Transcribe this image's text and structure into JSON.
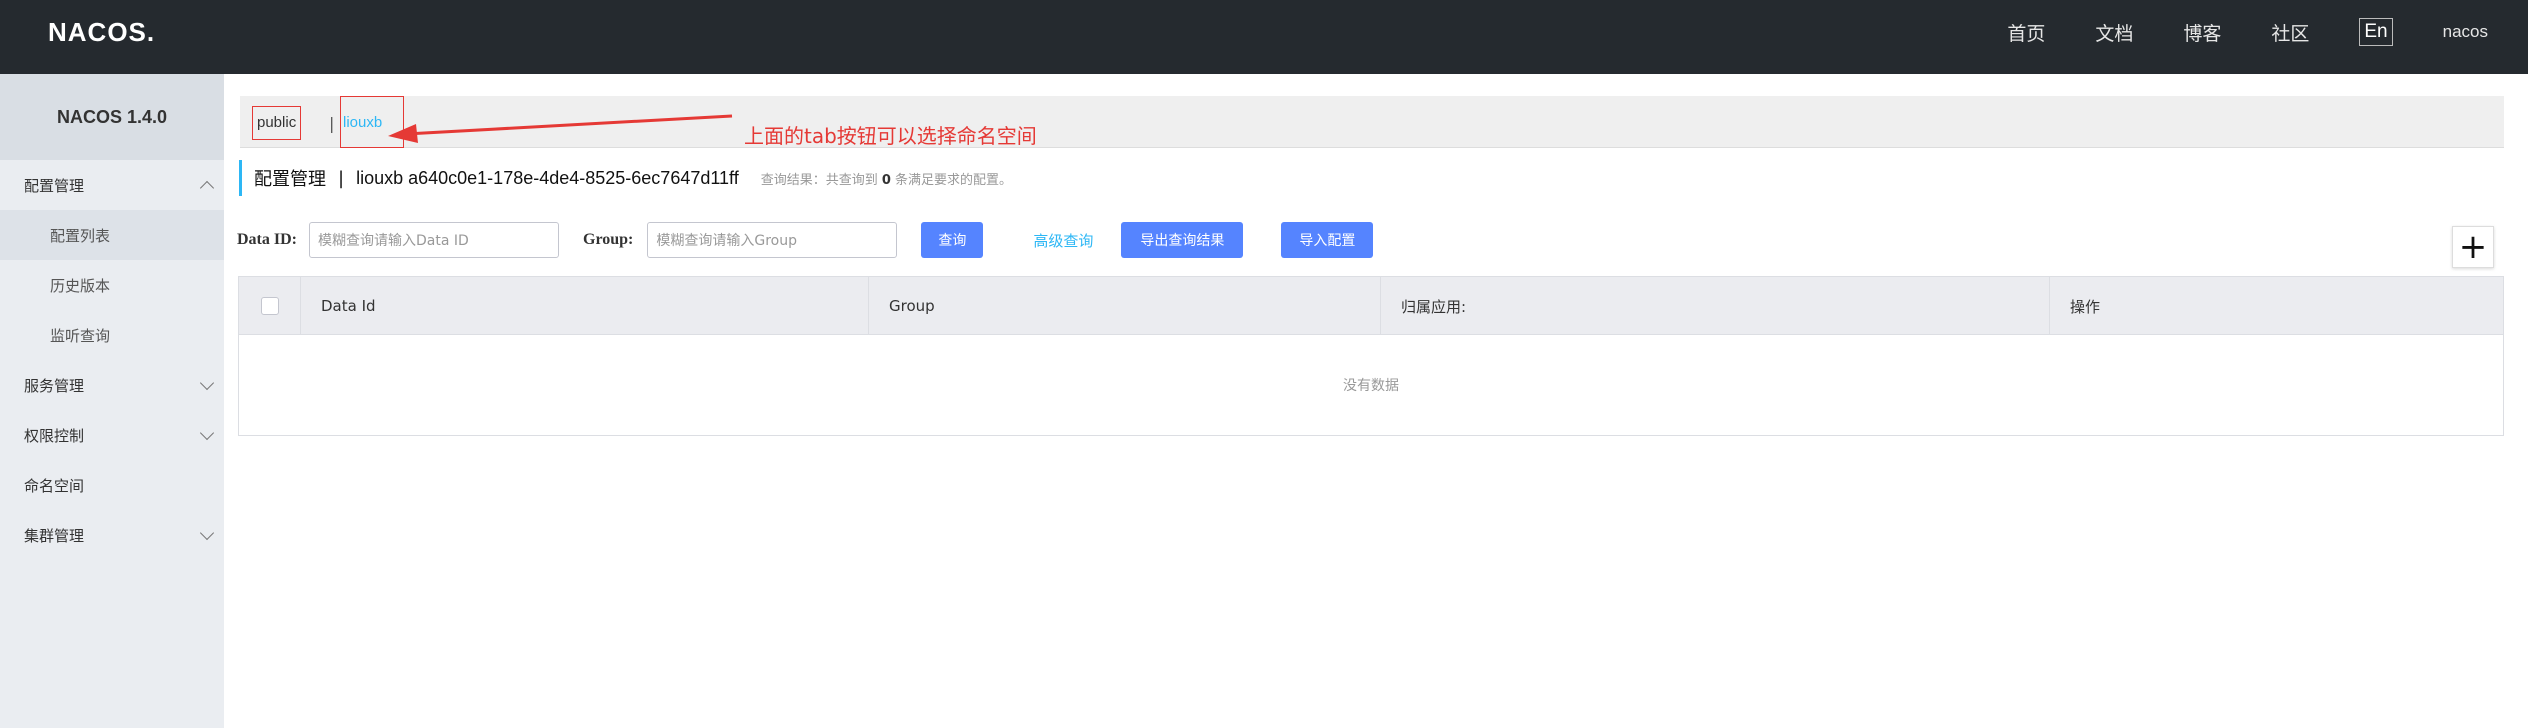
{
  "header": {
    "logo_text": "NACOS.",
    "nav": [
      "首页",
      "文档",
      "博客",
      "社区"
    ],
    "lang_button": "En",
    "user": "nacos"
  },
  "sidebar": {
    "title": "NACOS 1.4.0",
    "items": [
      {
        "label": "配置管理",
        "expanded": true
      },
      {
        "label": "配置列表",
        "sub": true,
        "active": true
      },
      {
        "label": "历史版本",
        "sub": true
      },
      {
        "label": "监听查询",
        "sub": true
      },
      {
        "label": "服务管理",
        "expanded": false
      },
      {
        "label": "权限控制",
        "expanded": false
      },
      {
        "label": "命名空间"
      },
      {
        "label": "集群管理",
        "expanded": false
      }
    ]
  },
  "namespaces": {
    "public": "public",
    "separator": "|",
    "current": "liouxb",
    "annotation": "上面的tab按钮可以选择命名空间"
  },
  "title": {
    "main": "配置管理",
    "separator": "|",
    "namespace": "liouxb  a640c0e1-178e-4de4-8525-6ec7647d11ff",
    "result_prefix": "查询结果：共查询到 ",
    "result_count": "0",
    "result_suffix": " 条满足要求的配置。"
  },
  "search": {
    "data_id_label": "Data ID:",
    "data_id_placeholder": "模糊查询请输入Data ID",
    "group_label": "Group:",
    "group_placeholder": "模糊查询请输入Group",
    "query_button": "查询",
    "advanced_link": "高级查询",
    "export_button": "导出查询结果",
    "import_button": "导入配置"
  },
  "add_button": "+",
  "table": {
    "columns": [
      "Data Id",
      "Group",
      "归属应用:",
      "操作"
    ],
    "empty_text": "没有数据"
  },
  "colors": {
    "topbar": "#252a2f",
    "sidebar": "#eaedf1",
    "accent": "#5584ff",
    "link": "#2db7f5",
    "annotation": "#e53935"
  }
}
